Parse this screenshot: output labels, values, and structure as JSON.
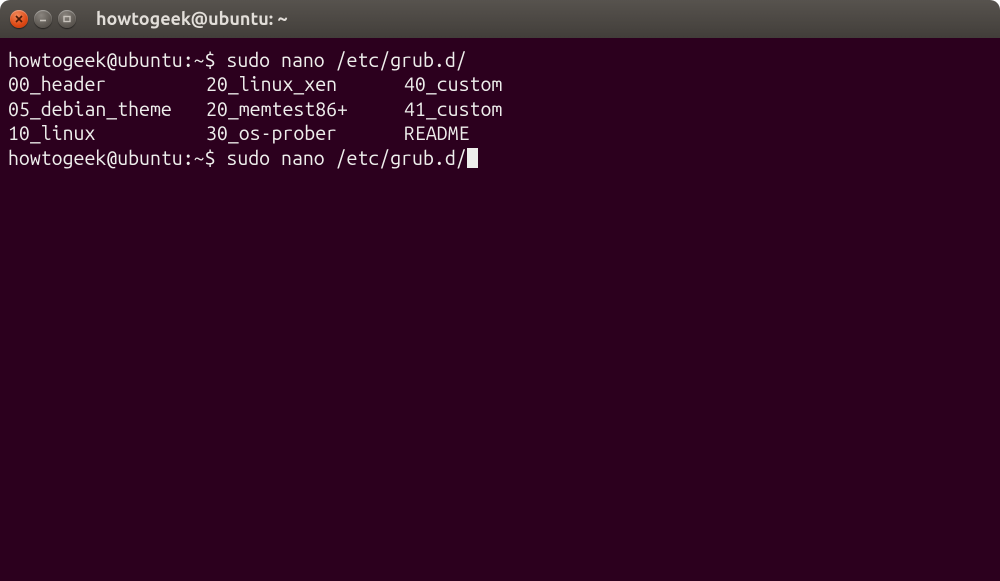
{
  "window": {
    "title": "howtogeek@ubuntu: ~"
  },
  "terminal": {
    "prompt1_user_host": "howtogeek@ubuntu",
    "prompt1_path": "~",
    "prompt1_cmd": "sudo nano /etc/grub.d/",
    "listing": [
      {
        "c1": "00_header",
        "c2": "20_linux_xen",
        "c3": "40_custom"
      },
      {
        "c1": "05_debian_theme",
        "c2": "20_memtest86+",
        "c3": "41_custom"
      },
      {
        "c1": "10_linux",
        "c2": "30_os-prober",
        "c3": "README"
      }
    ],
    "prompt2_user_host": "howtogeek@ubuntu",
    "prompt2_path": "~",
    "prompt2_cmd": "sudo nano /etc/grub.d/"
  }
}
